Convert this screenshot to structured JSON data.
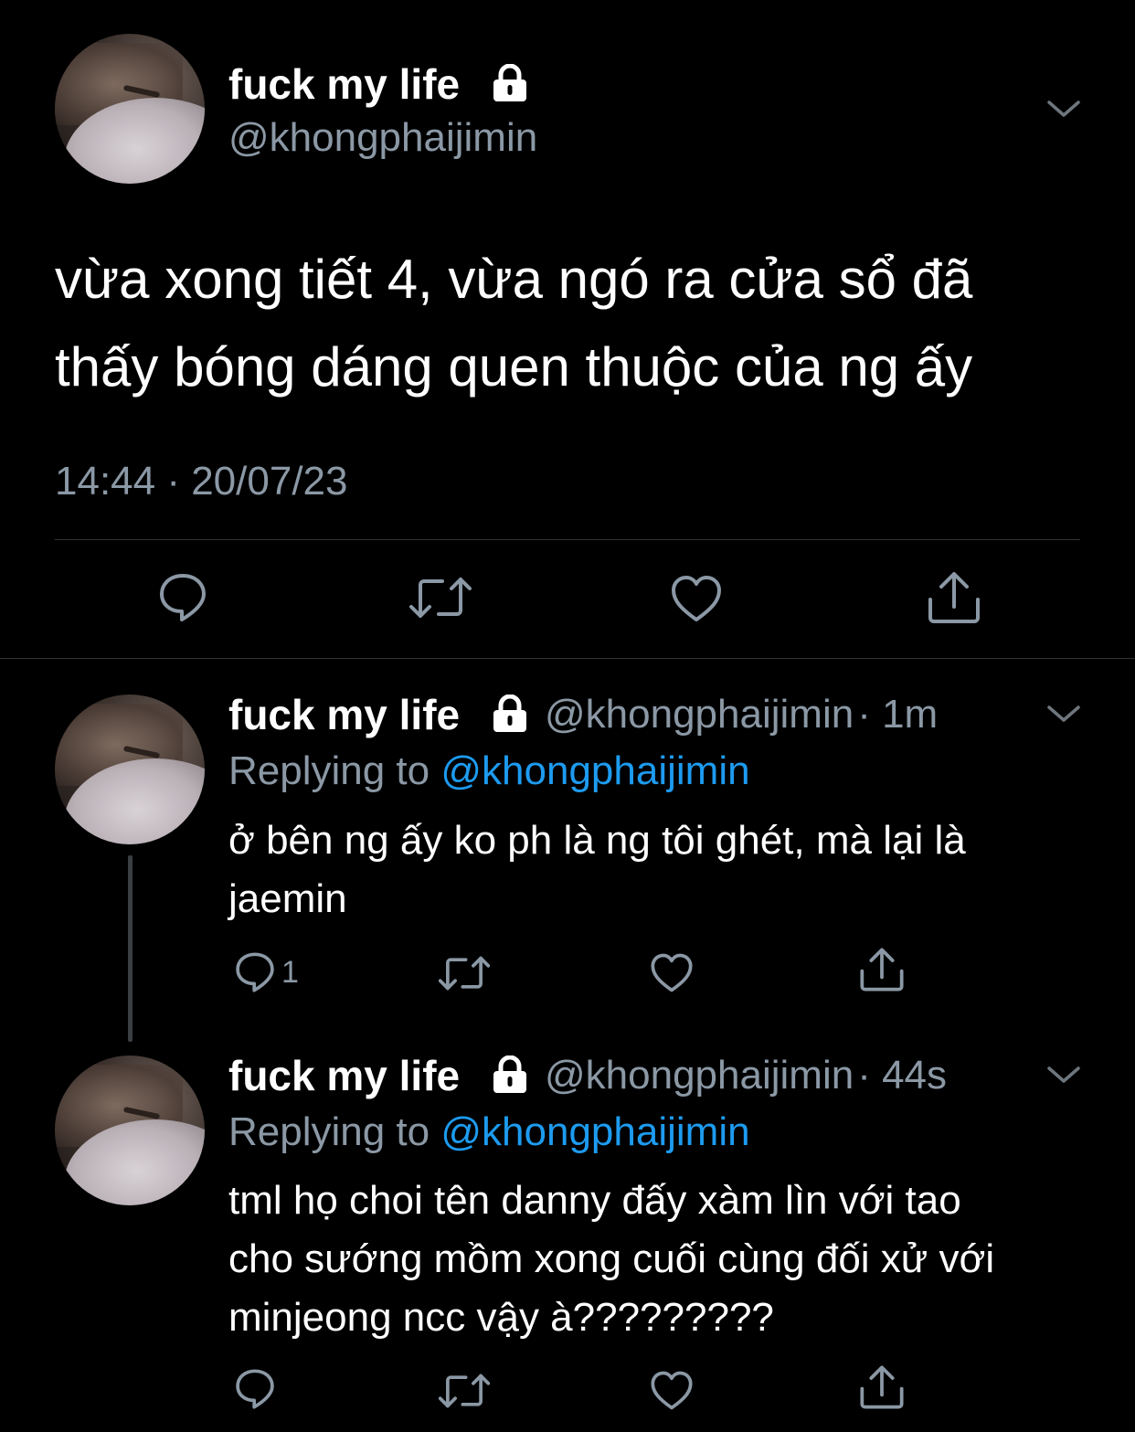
{
  "main_tweet": {
    "display_name": "fuck my life",
    "handle": "@khongphaijimin",
    "text_line1": "vừa xong tiết 4, vừa ngó ra cửa sổ đã",
    "text_line2": "thấy bóng dáng quen thuộc của ng ấy",
    "timestamp": "14:44 · 20/07/23"
  },
  "replies": [
    {
      "display_name": "fuck my life",
      "handle": "@khongphaijimin",
      "time": "· 1m",
      "replying_to_label": "Replying to",
      "replying_to_handle": "@khongphaijimin",
      "text_line1": "ở bên ng ấy ko ph là ng tôi ghét, mà lại là",
      "text_line2": "jaemin",
      "reply_count": "1"
    },
    {
      "display_name": "fuck my life",
      "handle": "@khongphaijimin",
      "time": "· 44s",
      "replying_to_label": "Replying to",
      "replying_to_handle": "@khongphaijimin",
      "text_line1": "tml họ choi tên danny đấy xàm lìn với tao",
      "text_line2": "cho sướng mồm xong cuối cùng đối xử với",
      "text_line3": "minjeong ncc vậy à?????????"
    }
  ],
  "colors": {
    "background": "#000000",
    "text": "#ffffff",
    "secondary": "#8b98a5",
    "link": "#1d9bf0",
    "divider": "#2f3336"
  },
  "icons": [
    "lock-icon",
    "chevron-down-icon",
    "reply-icon",
    "retweet-icon",
    "like-icon",
    "share-icon"
  ]
}
